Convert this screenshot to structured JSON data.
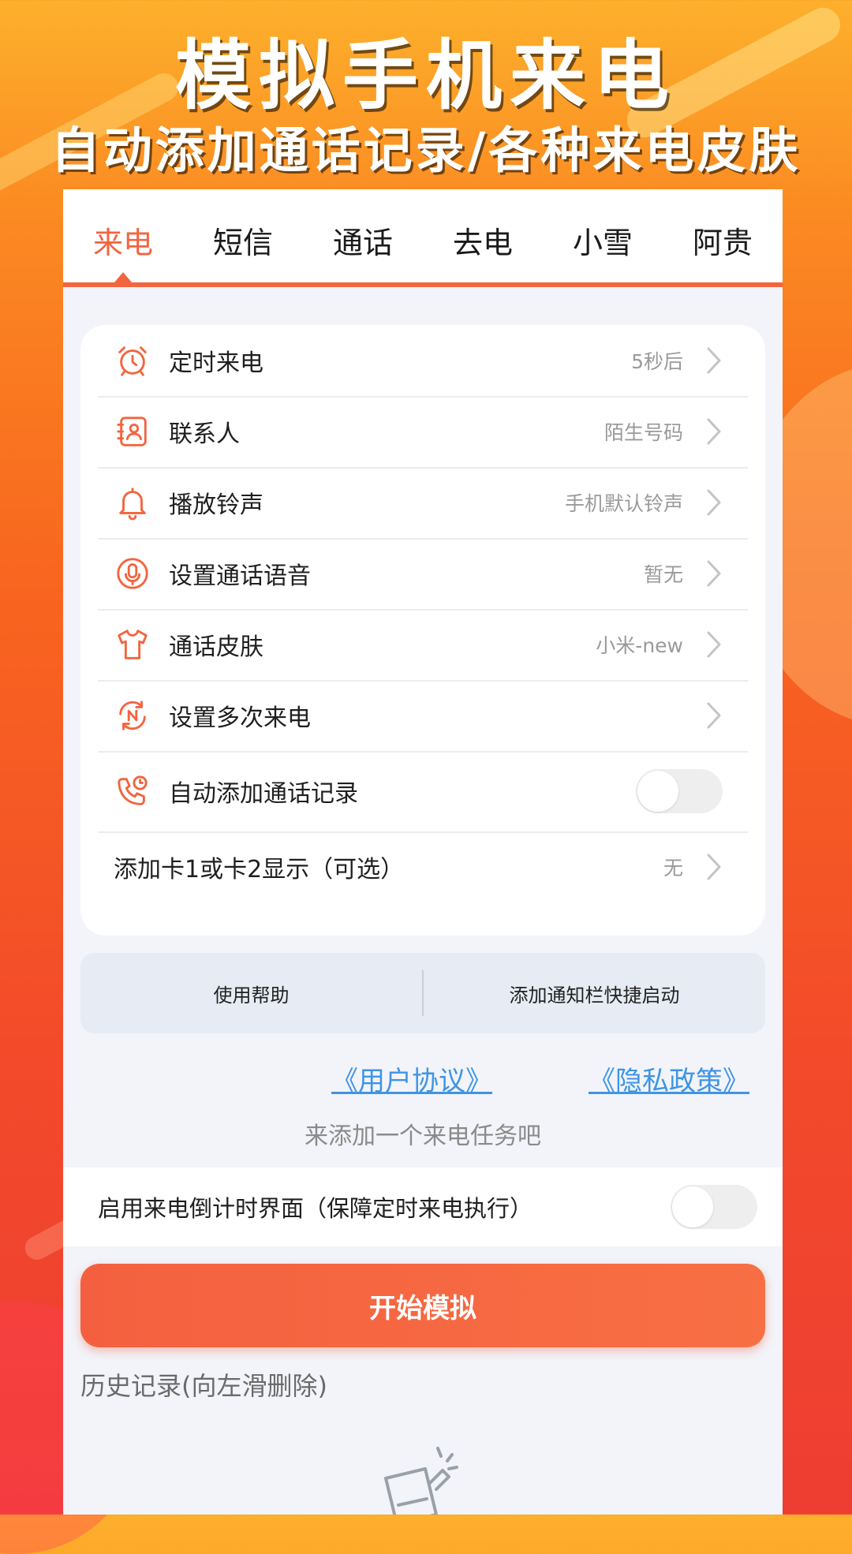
{
  "hero": {
    "title": "模拟手机来电",
    "subtitle": "自动添加通话记录/各种来电皮肤"
  },
  "tabs": [
    {
      "label": "来电",
      "active": true
    },
    {
      "label": "短信",
      "active": false
    },
    {
      "label": "通话",
      "active": false
    },
    {
      "label": "去电",
      "active": false
    },
    {
      "label": "小雪",
      "active": false
    },
    {
      "label": "阿贵",
      "active": false
    }
  ],
  "settings": [
    {
      "icon": "alarm-clock-icon",
      "label": "定时来电",
      "value": "5秒后"
    },
    {
      "icon": "contact-book-icon",
      "label": "联系人",
      "value": "陌生号码"
    },
    {
      "icon": "bell-icon",
      "label": "播放铃声",
      "value": "手机默认铃声"
    },
    {
      "icon": "microphone-icon",
      "label": "设置通话语音",
      "value": "暂无"
    },
    {
      "icon": "tshirt-icon",
      "label": "通话皮肤",
      "value": "小米-new"
    },
    {
      "icon": "repeat-n-icon",
      "label": "设置多次来电",
      "value": ""
    },
    {
      "icon": "phone-clock-icon",
      "label": "自动添加通话记录",
      "toggle": false
    },
    {
      "label": "添加卡1或卡2显示（可选）",
      "value": "无"
    }
  ],
  "help_bar": {
    "help": "使用帮助",
    "shortcut": "添加通知栏快捷启动"
  },
  "links": {
    "agreement": "《用户协议》",
    "privacy": "《隐私政策》"
  },
  "hint": "来添加一个来电任务吧",
  "countdown": {
    "label": "启用来电倒计时界面（保障定时来电执行）",
    "enabled": false
  },
  "start_button": "开始模拟",
  "history_title": "历史记录(向左滑删除)",
  "colors": {
    "accent": "#f2653f",
    "link": "#3e95e6",
    "background_top": "#fdb02c",
    "background_bottom": "#ee3d33"
  }
}
